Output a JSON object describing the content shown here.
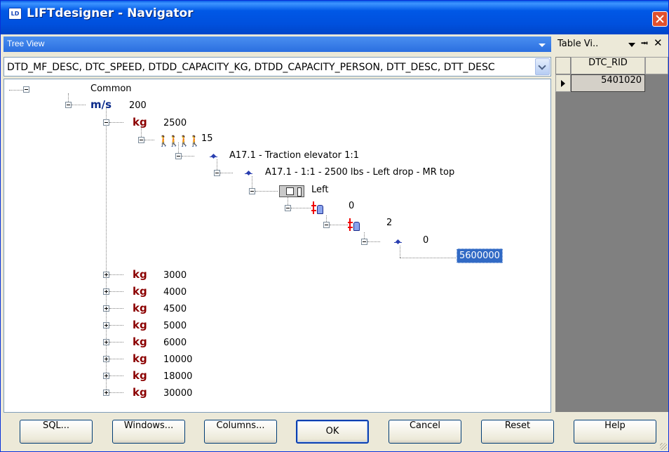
{
  "window": {
    "app_icon": "LD",
    "title": "LIFTdesigner - Navigator",
    "close_icon": "close-icon"
  },
  "tree_view": {
    "header": "Tree View",
    "fields": "DTD_MF_DESC, DTC_SPEED, DTDD_CAPACITY_KG, DTDD_CAPACITY_PERSON, DTT_DESC, DTT_DESC",
    "root": "Common",
    "speed_unit": "m/s",
    "speed": "200",
    "capacity_unit": "kg",
    "expanded_capacity": "2500",
    "persons": "15",
    "persons_icon": "persons-icon",
    "type_1": "A17.1 - Traction elevator 1:1",
    "type_2": "A17.1 - 1:1 - 2500 lbs - Left drop - MR top",
    "door": "Left",
    "level_a": "0",
    "level_b": "2",
    "level_c": "0",
    "selected": "5600000",
    "collapsed_capacities": [
      "3000",
      "4000",
      "4500",
      "5000",
      "6000",
      "10000",
      "18000",
      "30000"
    ]
  },
  "table_view": {
    "title": "Table Vi..",
    "pin": "—ł",
    "close": "✕",
    "column": "DTC_RID",
    "value": "5401020"
  },
  "buttons": {
    "sql": "SQL...",
    "windows": "Windows...",
    "columns": "Columns...",
    "ok": "OK",
    "cancel": "Cancel",
    "reset": "Reset",
    "help": "Help"
  }
}
